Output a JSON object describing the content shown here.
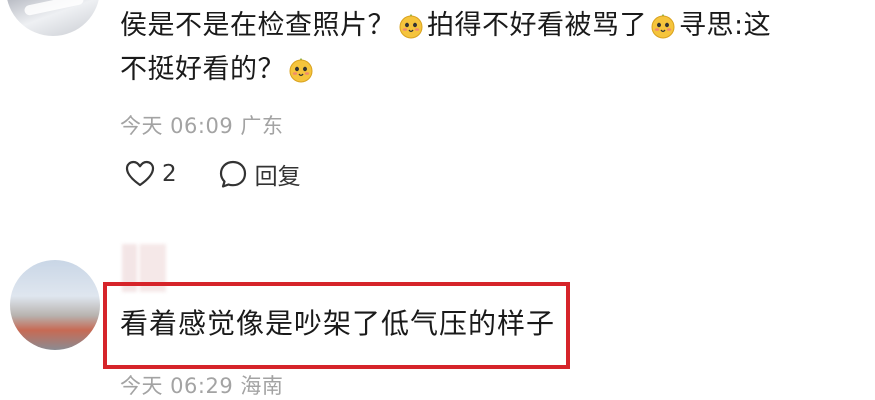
{
  "comment1": {
    "text_part1": "侯是不是在检查照片？",
    "text_part2": "拍得不好看被骂了",
    "text_part3": "寻思:这",
    "text_part4": "不挺好看的？",
    "emoji_icon": "cute-face-emoji-icon",
    "time": "今天 06:09",
    "location": "广东",
    "likes": "2",
    "reply_label": "回复"
  },
  "comment2": {
    "text": "看着感觉像是吵架了低气压的样子",
    "time": "今天 06:29",
    "location": "海南"
  },
  "colors": {
    "highlight": "#d6242a",
    "meta_gray": "#a3a3a3",
    "emoji_yellow": "#f5c43c"
  }
}
